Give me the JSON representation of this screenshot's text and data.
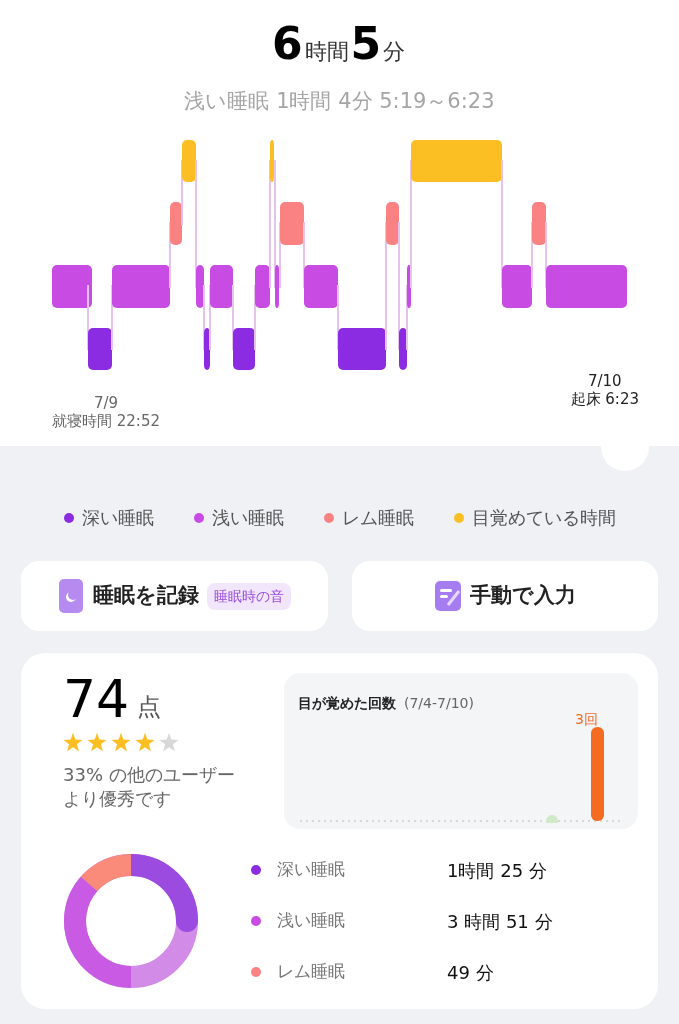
{
  "summary": {
    "hours": "6",
    "hours_unit": "時間",
    "minutes": "5",
    "minutes_unit": "分"
  },
  "selection": "浅い睡眠 1時間 4分 5:19～6:23",
  "bedtime": {
    "date": "7/9",
    "label": "就寝時間 22:52"
  },
  "wake": {
    "date": "7/10",
    "label": "起床 6:23"
  },
  "legend": [
    {
      "label": "深い睡眠",
      "color": "#8b2be2"
    },
    {
      "label": "浅い睡眠",
      "color": "#c84be3"
    },
    {
      "label": "レム睡眠",
      "color": "#fa8282"
    },
    {
      "label": "目覚めている時間",
      "color": "#fbbf24"
    }
  ],
  "actions": [
    {
      "kind": "record",
      "label": "睡眠を記録",
      "tag": "睡眠時の音"
    },
    {
      "kind": "manual",
      "label": "手動で入力"
    }
  ],
  "score": {
    "value": "74",
    "unit": "点",
    "stars": 4,
    "comparison": "33% の他のユーザーより優秀です"
  },
  "wake_count": {
    "title": "目が覚めた回数",
    "range": "(7/4-7/10)",
    "bar_label": "3回"
  },
  "breakdown": [
    {
      "label": "深い睡眠",
      "value": "1時間 25 分",
      "color": "#8b2be2"
    },
    {
      "label": "浅い睡眠",
      "value": "3 時間 51 分",
      "color": "#c84be3"
    },
    {
      "label": "レム睡眠",
      "value": "49 分",
      "color": "#fa8282"
    }
  ]
}
